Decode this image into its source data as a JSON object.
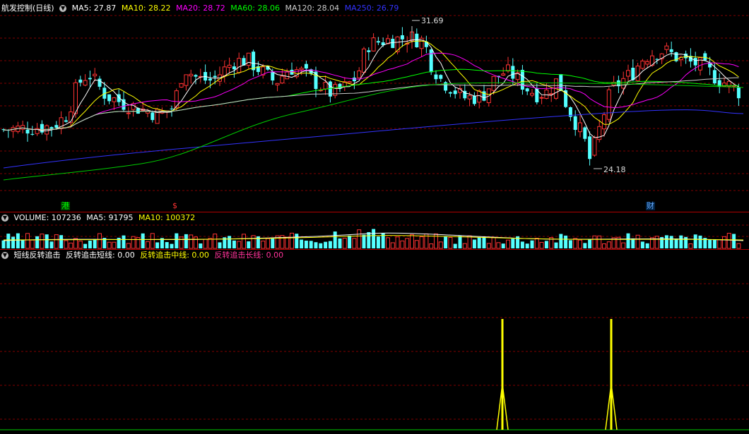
{
  "main": {
    "title": "航发控制(日线)",
    "ma": [
      {
        "label": "MA5: 27.87",
        "color": "#ffffff"
      },
      {
        "label": "MA10: 28.22",
        "color": "#ffff00"
      },
      {
        "label": "MA20: 28.72",
        "color": "#ff00ff"
      },
      {
        "label": "MA60: 28.06",
        "color": "#00ff00"
      },
      {
        "label": "MA120: 28.04",
        "color": "#cccccc"
      },
      {
        "label": "MA250: 26.79",
        "color": "#3333ff"
      }
    ],
    "high_label": "31.69",
    "low_label": "24.18",
    "markers": [
      {
        "text": "港",
        "color": "#00ff00",
        "bg": "#004400"
      },
      {
        "text": "$",
        "color": "#ff3333",
        "bg": "#000000"
      },
      {
        "text": "财",
        "color": "#66aaff",
        "bg": "#002244"
      }
    ]
  },
  "volume": {
    "title": "VOLUME: 107236",
    "ma5": "MA5: 91795",
    "ma10": "MA10: 100372"
  },
  "indicator": {
    "title": "短线反转追击",
    "short": "反转追击短线: 0.00",
    "mid": "反转追击中线: 0.00",
    "long": "反转追击长线: 0.00"
  },
  "colors": {
    "up": "#ff3333",
    "down": "#54ffff",
    "grid": "#800000",
    "signal": "#ffff00"
  }
}
